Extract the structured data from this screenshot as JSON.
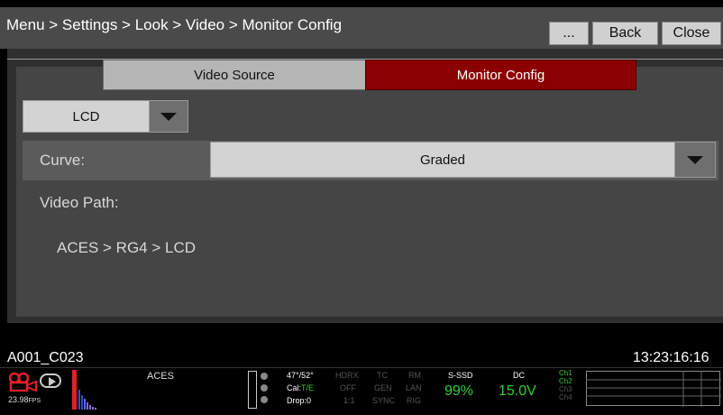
{
  "header": {
    "breadcrumb": "Menu > Settings > Look > Video > Monitor Config",
    "more_label": "...",
    "back_label": "Back",
    "close_label": "Close"
  },
  "tabs": [
    {
      "label": "Video Source",
      "selected": false
    },
    {
      "label": "Monitor Config",
      "selected": true
    }
  ],
  "monitor_select": {
    "value": "LCD"
  },
  "curve": {
    "label": "Curve:",
    "value": "Graded"
  },
  "video_path": {
    "label": "Video Path:",
    "value": "ACES > RG4 > LCD"
  },
  "clip_name": "A001_C023",
  "timecode": "13:23:16:16",
  "status": {
    "fps_value": "23.98",
    "fps_unit": "FPS",
    "color_space": "ACES",
    "temp": "47°/52°",
    "cal_prefix": "Cal:",
    "cal_value": "T/E",
    "drop": "Drop:0",
    "hdrx": "HDRX",
    "hdrx_value": "OFF",
    "ratio": "1:1",
    "tc": "TC",
    "gen": "GEN",
    "sync": "SYNC",
    "rm": "RM",
    "lan": "LAN",
    "rig": "RIG",
    "media_label": "S-SSD",
    "media_value": "99%",
    "power_label": "DC",
    "power_value": "15.0V",
    "channels": [
      "Ch1",
      "Ch2",
      "Ch3",
      "Ch4"
    ]
  },
  "colors": {
    "selected_tab": "#8b0000",
    "status_green": "#33cc33",
    "histogram_red": "#e0202a"
  }
}
